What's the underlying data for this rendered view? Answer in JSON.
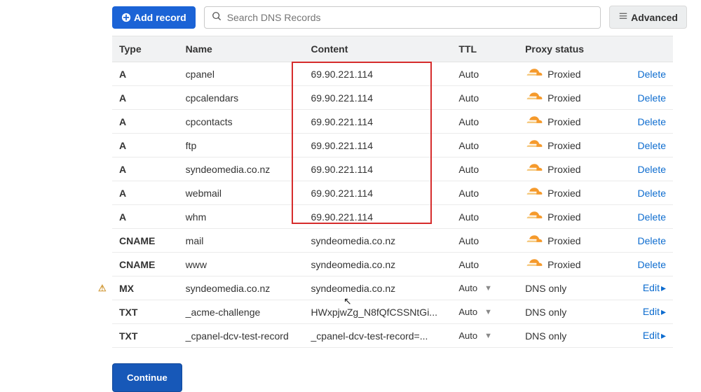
{
  "toolbar": {
    "add_label": "Add record",
    "search_placeholder": "Search DNS Records",
    "advanced_label": "Advanced"
  },
  "columns": {
    "type": "Type",
    "name": "Name",
    "content": "Content",
    "ttl": "TTL",
    "proxy": "Proxy status"
  },
  "proxy_labels": {
    "proxied": "Proxied",
    "dns_only": "DNS only"
  },
  "actions": {
    "delete": "Delete",
    "edit": "Edit"
  },
  "ttl_auto": "Auto",
  "records": [
    {
      "type": "A",
      "name": "cpanel",
      "content": "69.90.221.114",
      "ttl": "Auto",
      "ttl_drop": false,
      "proxy": "proxied",
      "action": "delete"
    },
    {
      "type": "A",
      "name": "cpcalendars",
      "content": "69.90.221.114",
      "ttl": "Auto",
      "ttl_drop": false,
      "proxy": "proxied",
      "action": "delete"
    },
    {
      "type": "A",
      "name": "cpcontacts",
      "content": "69.90.221.114",
      "ttl": "Auto",
      "ttl_drop": false,
      "proxy": "proxied",
      "action": "delete"
    },
    {
      "type": "A",
      "name": "ftp",
      "content": "69.90.221.114",
      "ttl": "Auto",
      "ttl_drop": false,
      "proxy": "proxied",
      "action": "delete"
    },
    {
      "type": "A",
      "name": "syndeomedia.co.nz",
      "content": "69.90.221.114",
      "ttl": "Auto",
      "ttl_drop": false,
      "proxy": "proxied",
      "action": "delete"
    },
    {
      "type": "A",
      "name": "webmail",
      "content": "69.90.221.114",
      "ttl": "Auto",
      "ttl_drop": false,
      "proxy": "proxied",
      "action": "delete"
    },
    {
      "type": "A",
      "name": "whm",
      "content": "69.90.221.114",
      "ttl": "Auto",
      "ttl_drop": false,
      "proxy": "proxied",
      "action": "delete"
    },
    {
      "type": "CNAME",
      "name": "mail",
      "content": "syndeomedia.co.nz",
      "ttl": "Auto",
      "ttl_drop": false,
      "proxy": "proxied",
      "action": "delete"
    },
    {
      "type": "CNAME",
      "name": "www",
      "content": "syndeomedia.co.nz",
      "ttl": "Auto",
      "ttl_drop": false,
      "proxy": "proxied",
      "action": "delete"
    },
    {
      "type": "MX",
      "name": "syndeomedia.co.nz",
      "content": "syndeomedia.co.nz",
      "ttl": "Auto",
      "ttl_drop": true,
      "proxy": "dns_only",
      "action": "edit",
      "warn": true
    },
    {
      "type": "TXT",
      "name": "_acme-challenge",
      "content": "HWxpjwZg_N8fQfCSSNtGi...",
      "ttl": "Auto",
      "ttl_drop": true,
      "proxy": "dns_only",
      "action": "edit"
    },
    {
      "type": "TXT",
      "name": "_cpanel-dcv-test-record",
      "content": "_cpanel-dcv-test-record=...",
      "ttl": "Auto",
      "ttl_drop": true,
      "proxy": "dns_only",
      "action": "edit"
    }
  ],
  "continue_label": "Continue"
}
